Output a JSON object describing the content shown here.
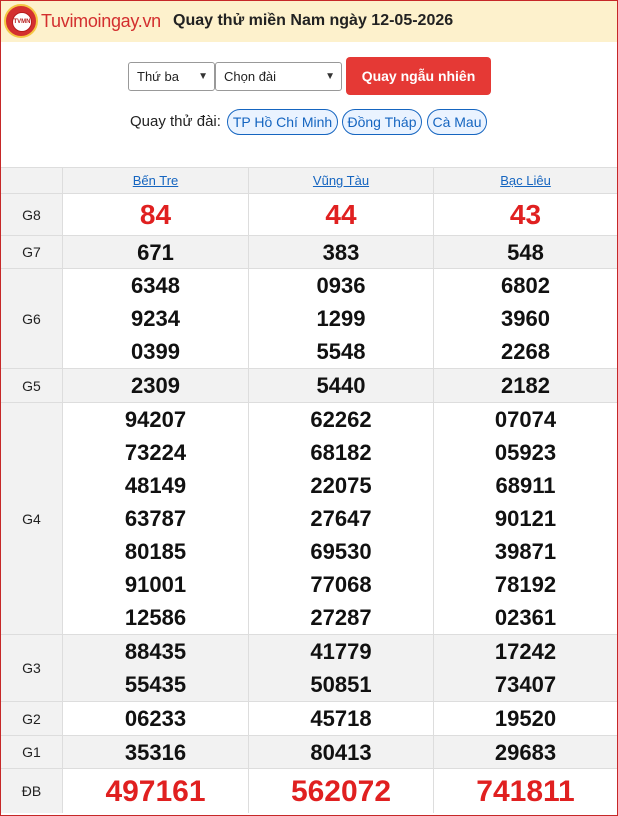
{
  "header": {
    "logo_mark": "TVMN",
    "logo_text": "Tuvimoingay.vn",
    "title": "Quay thử miền Nam ngày 12-05-2026"
  },
  "controls": {
    "day_select": "Thứ ba",
    "station_select": "Chọn đài",
    "random_button": "Quay ngẫu nhiên",
    "quay_label": "Quay thử đài:",
    "stations": [
      "TP Hồ Chí Minh",
      "Đồng Tháp",
      "Cà Mau"
    ]
  },
  "table": {
    "columns": [
      "Bến Tre",
      "Vũng Tàu",
      "Bạc Liêu"
    ],
    "prizes": [
      {
        "label": "G8",
        "values": [
          [
            "84"
          ],
          [
            "44"
          ],
          [
            "43"
          ]
        ]
      },
      {
        "label": "G7",
        "values": [
          [
            "671"
          ],
          [
            "383"
          ],
          [
            "548"
          ]
        ]
      },
      {
        "label": "G6",
        "values": [
          [
            "6348",
            "9234",
            "0399"
          ],
          [
            "0936",
            "1299",
            "5548"
          ],
          [
            "6802",
            "3960",
            "2268"
          ]
        ]
      },
      {
        "label": "G5",
        "values": [
          [
            "2309"
          ],
          [
            "5440"
          ],
          [
            "2182"
          ]
        ]
      },
      {
        "label": "G4",
        "values": [
          [
            "94207",
            "73224",
            "48149",
            "63787",
            "80185",
            "91001",
            "12586"
          ],
          [
            "62262",
            "68182",
            "22075",
            "27647",
            "69530",
            "77068",
            "27287"
          ],
          [
            "07074",
            "05923",
            "68911",
            "90121",
            "39871",
            "78192",
            "02361"
          ]
        ]
      },
      {
        "label": "G3",
        "values": [
          [
            "88435",
            "55435"
          ],
          [
            "41779",
            "50851"
          ],
          [
            "17242",
            "73407"
          ]
        ]
      },
      {
        "label": "G2",
        "values": [
          [
            "06233"
          ],
          [
            "45718"
          ],
          [
            "19520"
          ]
        ]
      },
      {
        "label": "G1",
        "values": [
          [
            "35316"
          ],
          [
            "80413"
          ],
          [
            "29683"
          ]
        ]
      },
      {
        "label": "ĐB",
        "values": [
          [
            "497161"
          ],
          [
            "562072"
          ],
          [
            "741811"
          ]
        ]
      }
    ]
  },
  "colors": {
    "accent": "#e53935",
    "link": "#1565c0",
    "header_bg": "#fdf1cc"
  }
}
